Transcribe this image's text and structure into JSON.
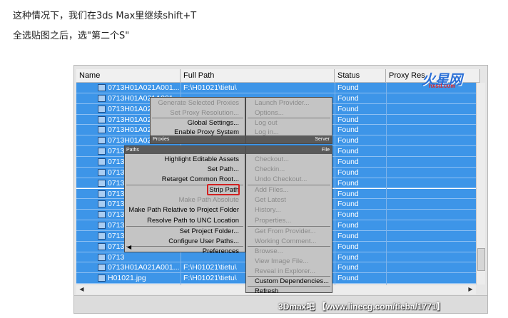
{
  "article": {
    "line1": "这种情况下，我们在3ds Max里继续shift+T",
    "line2": "全选贴图之后，选\"第二个S\""
  },
  "table": {
    "columns": [
      "Name",
      "Full Path",
      "Status",
      "Proxy Res"
    ],
    "rows": [
      {
        "name": "0713H01A021A001...",
        "path": "F:\\H01021\\tietu\\",
        "status": "Found"
      },
      {
        "name": "0713H01A021A001...",
        "path": "",
        "status": "Found"
      },
      {
        "name": "0713H01A02",
        "path": "",
        "status": "Found"
      },
      {
        "name": "0713H01A02",
        "path": "",
        "status": "Found"
      },
      {
        "name": "0713H01A02",
        "path": "",
        "status": "Found"
      },
      {
        "name": "0713H01A02",
        "path": "",
        "status": "Found"
      },
      {
        "name": "0713",
        "path": "",
        "status": "Found"
      },
      {
        "name": "0713",
        "path": "",
        "status": "Found"
      },
      {
        "name": "0713",
        "path": "",
        "status": "Found"
      },
      {
        "name": "0713",
        "path": "",
        "status": "Found"
      },
      {
        "name": "0713",
        "path": "",
        "status": "Found"
      },
      {
        "name": "0713",
        "path": "",
        "status": "Found"
      },
      {
        "name": "0713",
        "path": "",
        "status": "Found"
      },
      {
        "name": "0713",
        "path": "",
        "status": "Found"
      },
      {
        "name": "0713",
        "path": "",
        "status": "Found"
      },
      {
        "name": "0713",
        "path": "",
        "status": "Found"
      },
      {
        "name": "0713",
        "path": "",
        "status": "Found"
      },
      {
        "name": "0713H01A021A001...",
        "path": "F:\\H01021\\tietu\\",
        "status": "Found"
      },
      {
        "name": "H01021.jpg",
        "path": "F:\\H01021\\tietu\\",
        "status": "Found"
      }
    ]
  },
  "menu": {
    "proxies_title": "Proxies",
    "server_title": "Server",
    "paths_title": "Paths",
    "file_title": "File",
    "proxies_items": [
      {
        "label": "Generate Selected Proxies",
        "enabled": false
      },
      {
        "label": "Set Proxy Resolution...",
        "enabled": false
      },
      {
        "label": "Global Settings...",
        "enabled": true
      },
      {
        "label": "Enable Proxy System",
        "enabled": true
      }
    ],
    "server_items": [
      {
        "label": "Launch Provider...",
        "enabled": false
      },
      {
        "label": "Options...",
        "enabled": false
      },
      {
        "label": "Log out",
        "enabled": false
      },
      {
        "label": "Log in...",
        "enabled": false
      }
    ],
    "paths_items": [
      {
        "label": "Highlight Editable Assets",
        "enabled": true
      },
      {
        "label": "Set Path...",
        "enabled": true
      },
      {
        "label": "Retarget Common Root...",
        "enabled": true
      },
      {
        "label": "Strip Path",
        "enabled": true
      },
      {
        "label": "Make Path Absolute",
        "enabled": false
      },
      {
        "label": "Make Path Relative to Project Folder",
        "enabled": true
      },
      {
        "label": "Resolve Path to UNC Location",
        "enabled": true
      },
      {
        "label": "Set Project Folder...",
        "enabled": true
      },
      {
        "label": "Configure User Paths...",
        "enabled": true
      },
      {
        "label": "Preferences",
        "enabled": true
      }
    ],
    "file_items": [
      {
        "label": "Checkout...",
        "enabled": false
      },
      {
        "label": "Checkin...",
        "enabled": false
      },
      {
        "label": "Undo Checkout...",
        "enabled": false
      },
      {
        "label": "Add Files...",
        "enabled": false
      },
      {
        "label": "Get Latest",
        "enabled": false
      },
      {
        "label": "History...",
        "enabled": false
      },
      {
        "label": "Properties...",
        "enabled": false
      },
      {
        "label": "Get From Provider...",
        "enabled": false
      },
      {
        "label": "Working Comment...",
        "enabled": false
      },
      {
        "label": "Browse...",
        "enabled": false
      },
      {
        "label": "View Image File...",
        "enabled": false
      },
      {
        "label": "Reveal in Explorer...",
        "enabled": false
      },
      {
        "label": "Custom Dependencies...",
        "enabled": true
      },
      {
        "label": "Refresh",
        "enabled": true
      }
    ]
  },
  "logo": {
    "main": "火星网",
    "sub": "hxsd.com"
  },
  "watermark": "3Dmax吧 【www.linecg.com/tieba/1771】",
  "colors": {
    "selection": "#3d95e8",
    "menu_bg": "#c4c4c4",
    "highlight": "#d22020"
  }
}
